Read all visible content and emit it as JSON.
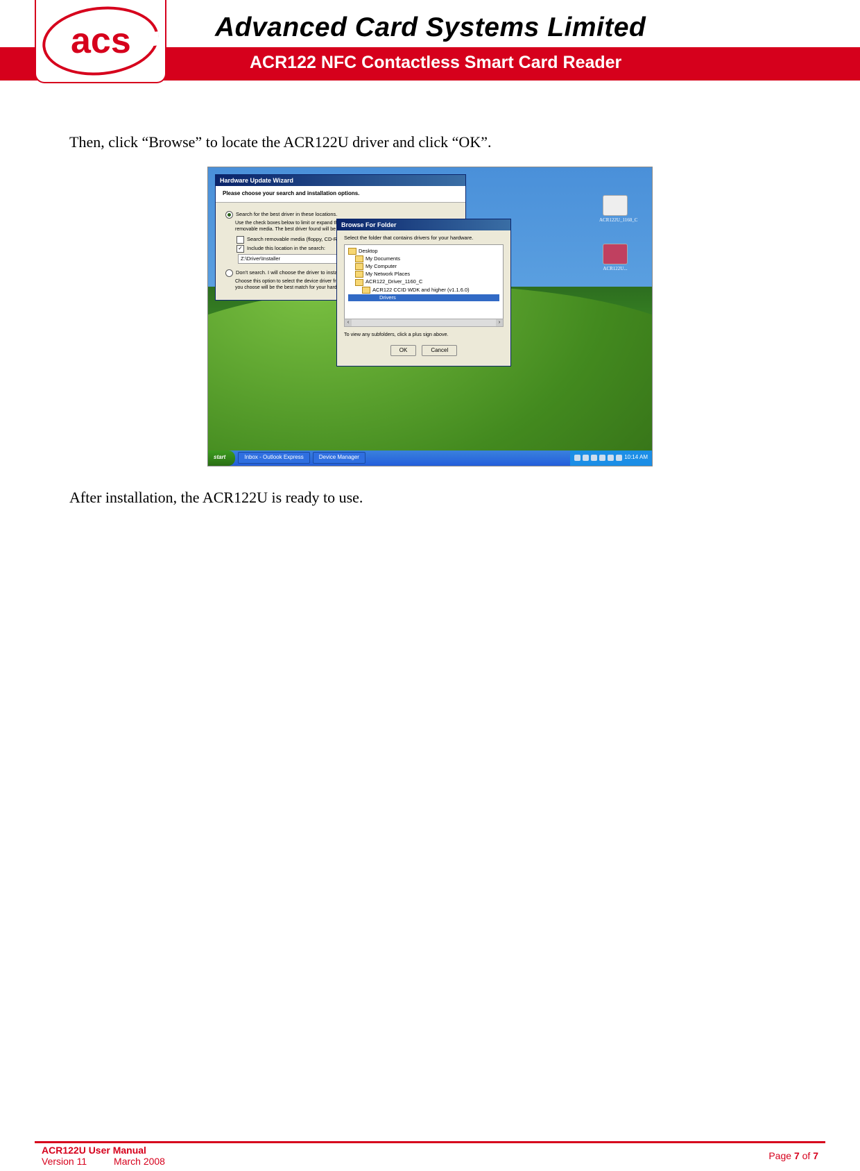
{
  "header": {
    "logo": "acs",
    "company": "Advanced Card Systems Limited",
    "subtitle": "ACR122 NFC Contactless Smart Card Reader"
  },
  "body": {
    "para1": "Then, click “Browse” to locate the ACR122U driver and click “OK”.",
    "para2": "After installation, the ACR122U is ready to use."
  },
  "screenshot": {
    "desktop_icons": {
      "i1": "ACR122U_1160_C",
      "i2": "ACR122U..."
    },
    "wizard": {
      "title": "Hardware Update Wizard",
      "heading": "Please choose your search and installation options.",
      "desc": "Use the check boxes below to limit or expand the default search, which includes local paths and removable media. The best driver found will be installed.",
      "opt1": "Search for the best driver in these locations.",
      "chk1": "Search removable media (floppy, CD-ROM...)",
      "chk2": "Include this location in the search:",
      "path": "Z:\\Driver\\Installer",
      "opt2": "Don't search. I will choose the driver to install.",
      "opt2_desc": "Choose this option to select the device driver from a list. Windows does not guarantee that the driver you choose will be the best match for your hardware."
    },
    "browse": {
      "title": "Browse For Folder",
      "hint": "Select the folder that contains drivers for your hardware.",
      "tree": {
        "n0": "Desktop",
        "n1": "My Documents",
        "n2": "My Computer",
        "n3": "My Network Places",
        "n4": "ACR122_Driver_1160_C",
        "n5": "ACR122 CCID WDK and higher (v1.1.6.0)",
        "n6": "Drivers"
      },
      "note": "To view any subfolders, click a plus sign above.",
      "ok": "OK",
      "cancel": "Cancel"
    },
    "taskbar": {
      "start": "start",
      "t1": "Inbox - Outlook Express",
      "t2": "Device Manager",
      "time": "10:14 AM"
    }
  },
  "footer": {
    "title": "ACR122U User Manual",
    "version_label": "Version 11",
    "date": "March 2008",
    "page_label": "Page ",
    "page_current": "7",
    "page_of": " of ",
    "page_total": "7"
  }
}
